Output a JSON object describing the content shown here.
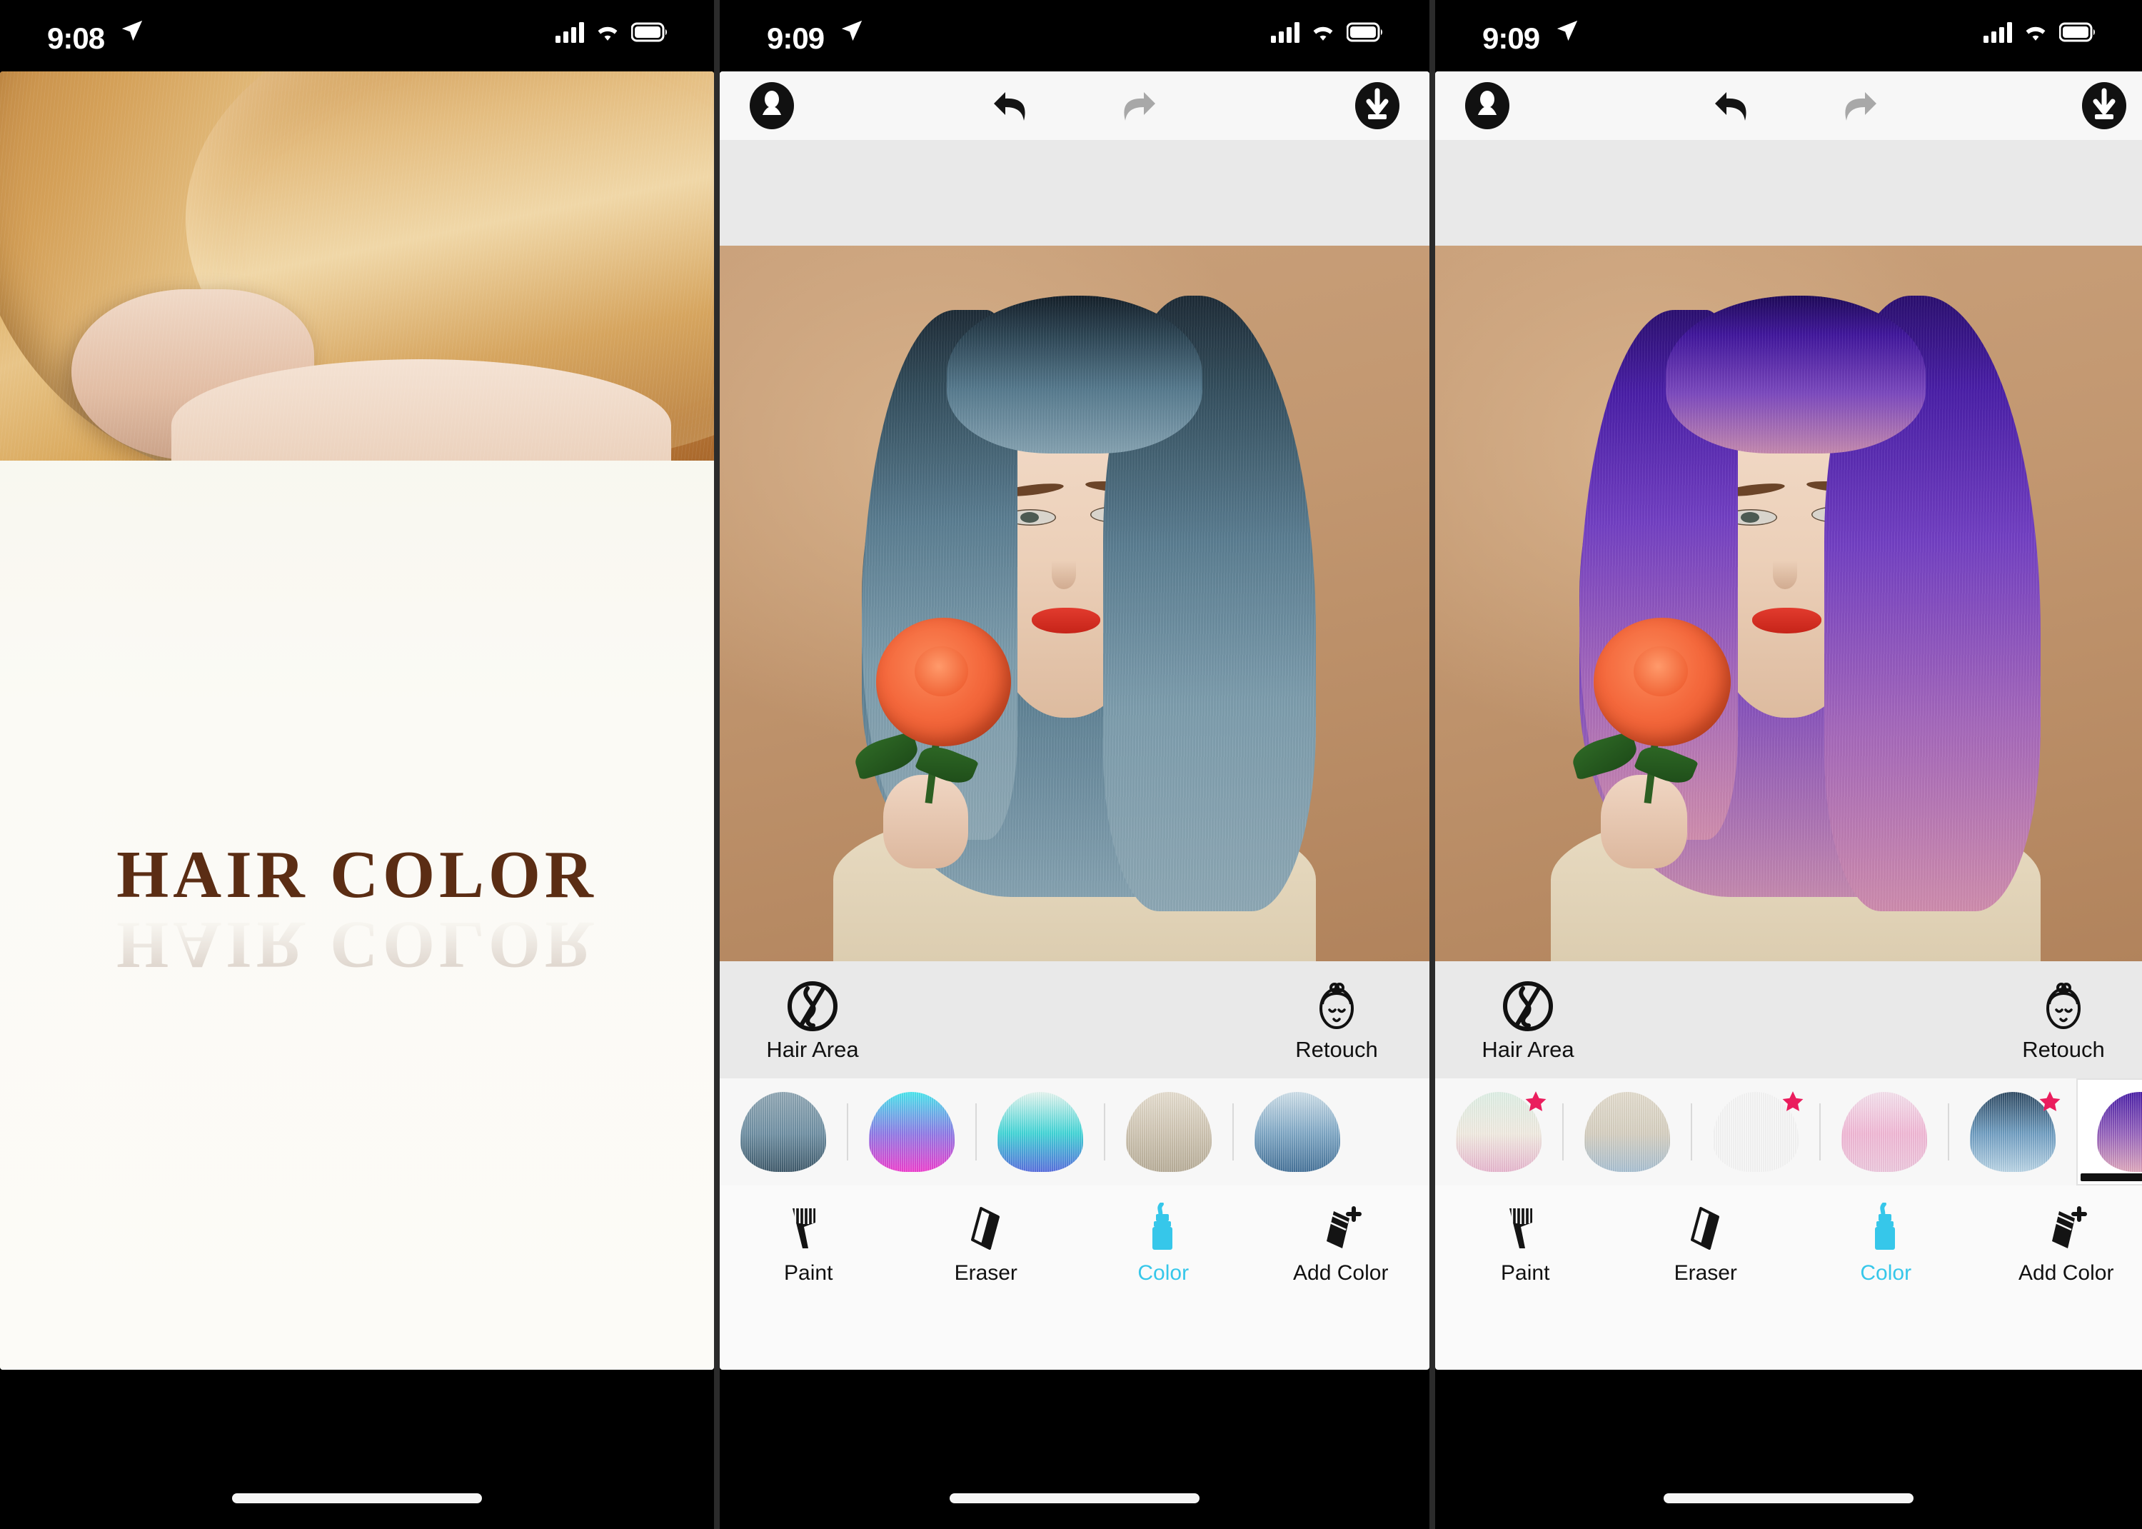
{
  "meta": {
    "accent_cyan": "#36c7ea",
    "star_pink": "#ea1d5d",
    "toolbar_bg": "#f7f7f7",
    "panel_gray": "#e9e9e9"
  },
  "panels": [
    {
      "id": "splash",
      "status": {
        "time": "9:08",
        "location_icon": "location-arrow-icon",
        "signal_icon": "cellular-bars-icon",
        "wifi_icon": "wifi-icon",
        "battery_icon": "battery-icon"
      },
      "title": "HAIR COLOR",
      "hero_image_alt": "blonde-hair-model-photo"
    },
    {
      "id": "editor-blue",
      "status": {
        "time": "9:09",
        "location_icon": "location-arrow-icon",
        "signal_icon": "cellular-bars-icon",
        "wifi_icon": "wifi-icon",
        "battery_icon": "battery-icon"
      },
      "topbar": {
        "portrait_button": "portrait-photo-icon",
        "undo_button": "undo-arrow-icon",
        "redo_button": "redo-arrow-icon",
        "save_button": "download-save-icon",
        "undo_enabled": true,
        "redo_enabled": false
      },
      "photo_alt": "model-with-blue-grey-hair",
      "tools": [
        {
          "label": "Hair Area",
          "icon": "hair-strand-circle-icon"
        },
        {
          "label": "Retouch",
          "icon": "face-retouch-icon"
        }
      ],
      "swatches": [
        {
          "name": "steel-blue-ombre",
          "premium": false,
          "selected": false,
          "top": "#90a7b4",
          "mid": "#6e8fa3",
          "bottom": "#3f5a6b"
        },
        {
          "name": "cyan-magenta-ombre",
          "premium": false,
          "selected": false,
          "top": "#49e8ef",
          "mid": "#8f7ae8",
          "bottom": "#f03fd0"
        },
        {
          "name": "aqua-blue-ombre",
          "premium": false,
          "selected": false,
          "top": "#e7f7f1",
          "mid": "#3fd6d8",
          "bottom": "#5a6fe0"
        },
        {
          "name": "platinum-blonde",
          "premium": false,
          "selected": false,
          "top": "#e6ded0",
          "mid": "#cfc5b2",
          "bottom": "#b9ae99"
        },
        {
          "name": "sky-blue-ombre",
          "premium": false,
          "selected": false,
          "top": "#cfe0ea",
          "mid": "#7fa8c6",
          "bottom": "#46739a"
        }
      ],
      "tabs": [
        {
          "label": "Paint",
          "icon": "paint-brush-icon",
          "active": false
        },
        {
          "label": "Eraser",
          "icon": "eraser-icon",
          "active": false
        },
        {
          "label": "Color",
          "icon": "color-tube-icon",
          "active": true
        },
        {
          "label": "Add Color",
          "icon": "add-color-icon",
          "active": false
        }
      ]
    },
    {
      "id": "editor-purple",
      "status": {
        "time": "9:09",
        "location_icon": "location-arrow-icon",
        "signal_icon": "cellular-bars-icon",
        "wifi_icon": "wifi-icon",
        "battery_icon": "battery-icon"
      },
      "topbar": {
        "portrait_button": "portrait-photo-icon",
        "undo_button": "undo-arrow-icon",
        "redo_button": "redo-arrow-icon",
        "save_button": "download-save-icon",
        "undo_enabled": true,
        "redo_enabled": false
      },
      "photo_alt": "model-with-purple-pink-hair",
      "tools": [
        {
          "label": "Hair Area",
          "icon": "hair-strand-circle-icon"
        },
        {
          "label": "Retouch",
          "icon": "face-retouch-icon"
        }
      ],
      "swatches": [
        {
          "name": "mint-pink-ombre",
          "premium": true,
          "selected": false,
          "top": "#dff0e6",
          "mid": "#f2ece2",
          "bottom": "#e8b7cf"
        },
        {
          "name": "ash-blonde-blue",
          "premium": false,
          "selected": false,
          "top": "#e3dccd",
          "mid": "#d6cfc0",
          "bottom": "#a8c0d2"
        },
        {
          "name": "violet-magenta",
          "premium": true,
          "selected": false,
          "top": "#5b2b9e",
          "mid": "#b martinez",
          "bottom": "#c7a3d8"
        },
        {
          "name": "baby-pink",
          "premium": false,
          "selected": false,
          "top": "#f6e2ee",
          "mid": "#f2b8d6",
          "bottom": "#eec8de"
        },
        {
          "name": "denim-blue-ombre",
          "premium": true,
          "selected": false,
          "top": "#2f4a63",
          "mid": "#6f9ec2",
          "bottom": "#b9d4e6"
        },
        {
          "name": "purple-rose-ombre",
          "premium": false,
          "selected": true,
          "top": "#4a1fa8",
          "mid": "#9562bd",
          "bottom": "#e0a8bd"
        }
      ],
      "tabs": [
        {
          "label": "Paint",
          "icon": "paint-brush-icon",
          "active": false
        },
        {
          "label": "Eraser",
          "icon": "eraser-icon",
          "active": false
        },
        {
          "label": "Color",
          "icon": "color-tube-icon",
          "active": true
        },
        {
          "label": "Add Color",
          "icon": "add-color-icon",
          "active": false
        }
      ]
    }
  ]
}
